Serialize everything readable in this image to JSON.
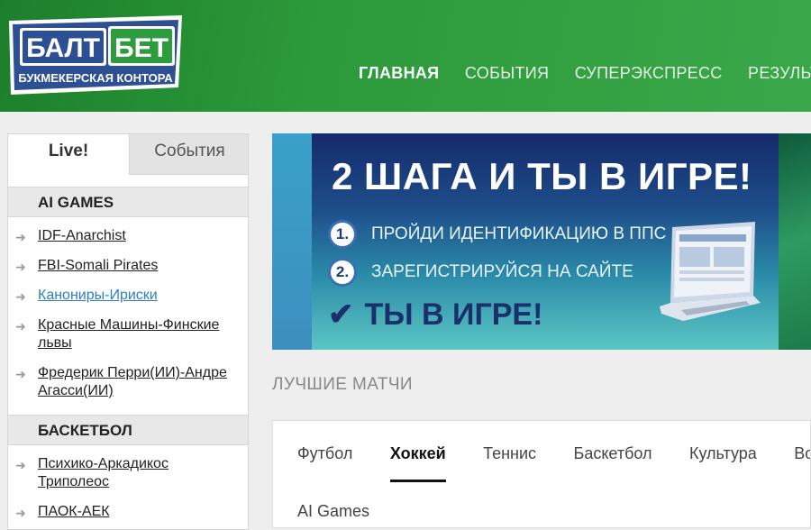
{
  "header": {
    "logo_top": "БАЛТ",
    "logo_top2": "БЕТ",
    "logo_sub": "БУКМЕКЕРСКАЯ КОНТОРА",
    "nav": [
      "ГЛАВНАЯ",
      "СОБЫТИЯ",
      "СУПЕРЭКСПРЕСС",
      "РЕЗУЛЬТАТ"
    ],
    "active_nav": "ГЛАВНАЯ"
  },
  "sidebar": {
    "tab_live": "Live!",
    "tab_events": "События",
    "categories": [
      {
        "title": "AI GAMES",
        "items": [
          {
            "label": "IDF-Anarchist",
            "link": false
          },
          {
            "label": "FBI-Somali Pirates",
            "link": false
          },
          {
            "label": "Канониры-Ириски",
            "link": true
          },
          {
            "label": "Красные Машины-Финские львы",
            "link": false
          },
          {
            "label": "Фредерик Перри(ИИ)-Андре Агасси(ИИ)",
            "link": false
          }
        ]
      },
      {
        "title": "БАСКЕТБОЛ",
        "items": [
          {
            "label": "Психико-Аркадикос Триполеос",
            "link": false
          },
          {
            "label": "ПАОК-АЕК",
            "link": false
          }
        ]
      }
    ],
    "arrow_icon": "arrow-right-icon"
  },
  "banner": {
    "title": "2 ШАГА И ТЫ В ИГРЕ!",
    "step1_num": "1.",
    "step1": "ПРОЙДИ ИДЕНТИФИКАЦИЮ В ППС",
    "step2_num": "2.",
    "step2": "ЗАРЕГИСТРИРУЙСЯ НА САЙТЕ",
    "final": "ТЫ В ИГРЕ!"
  },
  "best": {
    "title": "ЛУЧШИЕ МАТЧИ",
    "tabs": [
      "Футбол",
      "Хоккей",
      "Теннис",
      "Баскетбол",
      "Культура",
      "Во"
    ],
    "active_tab": "Хоккей",
    "sub_label": "AI Games"
  },
  "colors": {
    "header_green": "#2c9a3a",
    "link_blue": "#2f7fbd",
    "banner_navy": "#1b2f6a"
  }
}
